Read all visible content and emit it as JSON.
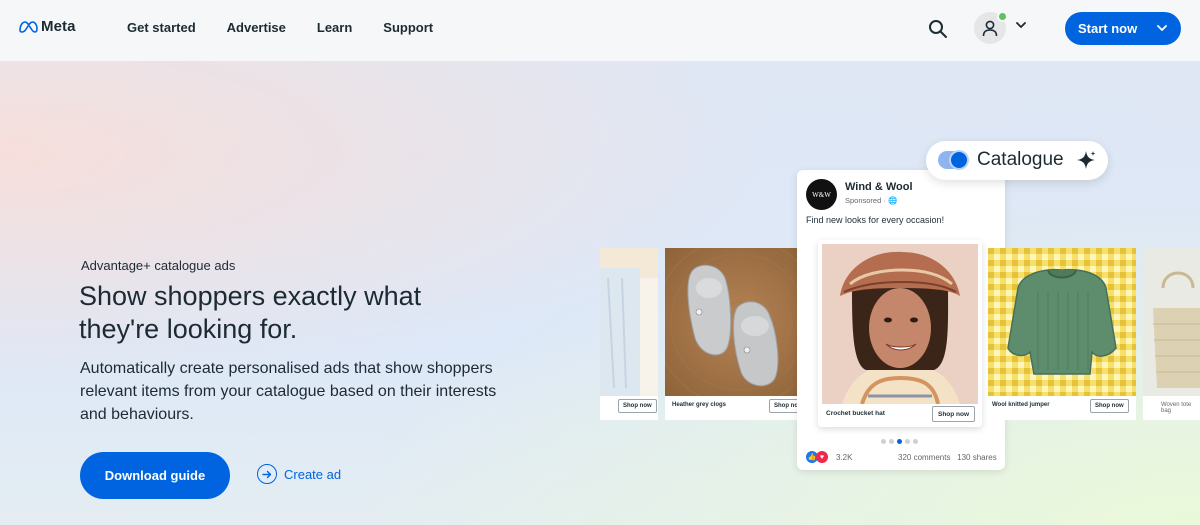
{
  "header": {
    "logo_text": "Meta",
    "nav": [
      "Get started",
      "Advertise",
      "Learn",
      "Support"
    ],
    "start_label": "Start now"
  },
  "hero": {
    "eyebrow": "Advantage+ catalogue ads",
    "headline": "Show shoppers exactly what they're looking for.",
    "description": "Automatically create personalised ads that show shoppers relevant items from your catalogue based on their interests and behaviours.",
    "download_label": "Download guide",
    "create_label": "Create ad"
  },
  "ad_preview": {
    "toggle_label": "Catalogue",
    "brand": "Wind & Wool",
    "avatar_text": "W&W",
    "sponsored": "Sponsored · 🌐",
    "post_text": "Find new looks for every occasion!",
    "main_item": "Crochet bucket hat",
    "shop_label": "Shop now",
    "left_item": "Heather grey clogs",
    "right_item": "Wool knitted jumper",
    "far_right_item": "Woven tote bag",
    "reaction_count": "3.2K",
    "comments": "320 comments",
    "shares": "130 shares",
    "carousel_dots": 5,
    "active_dot": 3
  },
  "colors": {
    "brand_blue": "#0064e0",
    "text": "#1c2b33"
  }
}
